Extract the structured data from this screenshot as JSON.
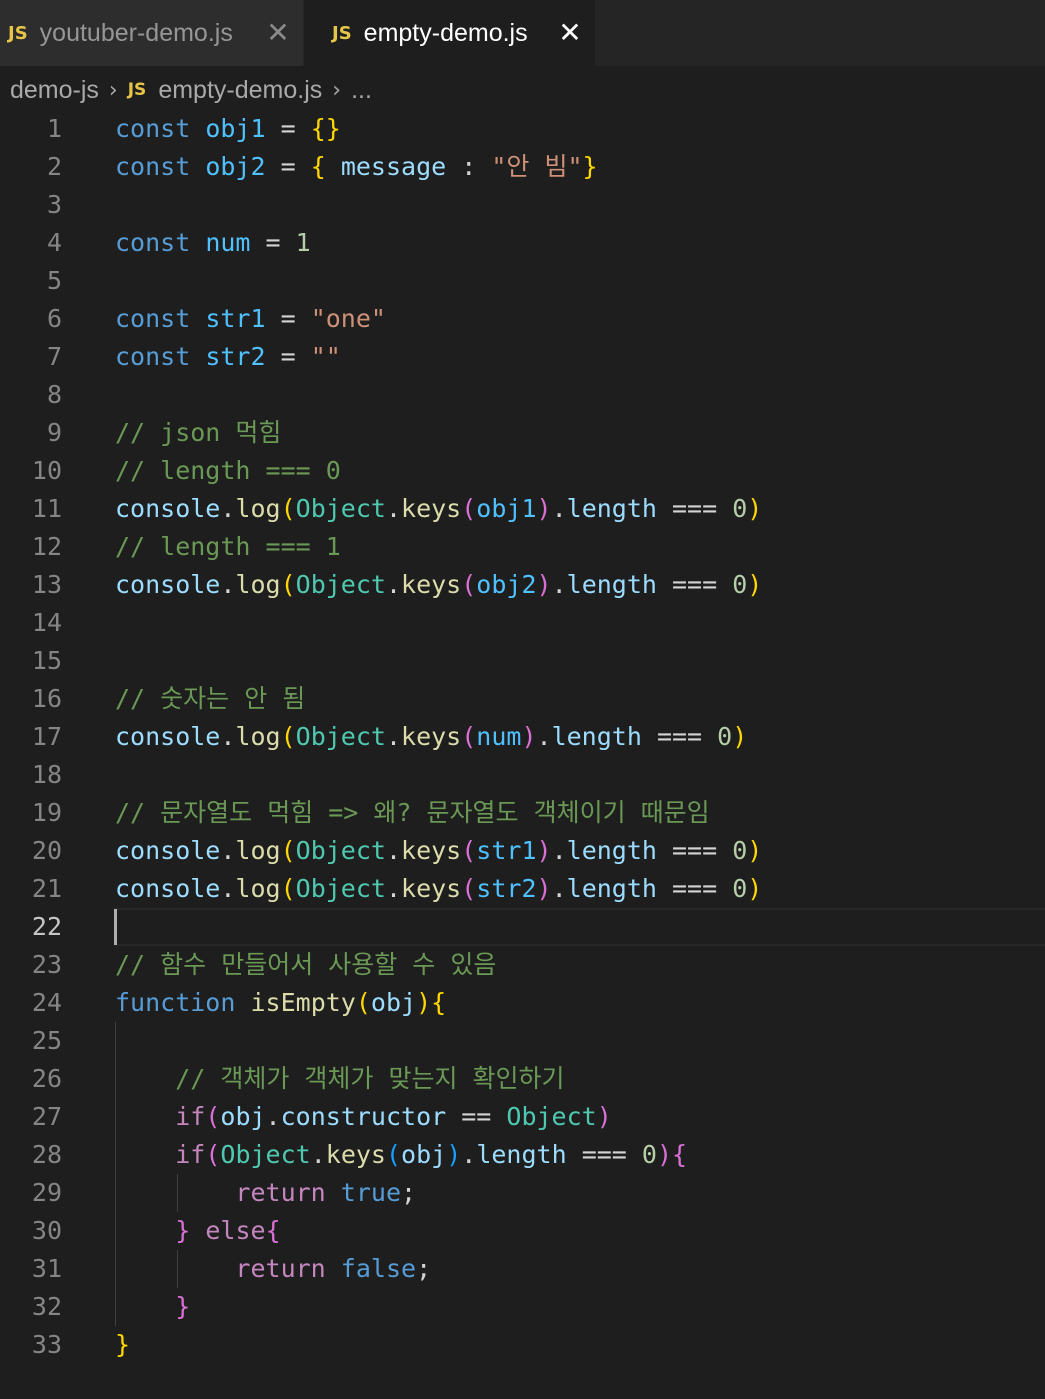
{
  "tabs": [
    {
      "badge": "JS",
      "label": "youtuber-demo.js",
      "close": "✕",
      "active": false
    },
    {
      "badge": "JS",
      "label": "empty-demo.js",
      "close": "✕",
      "active": true
    }
  ],
  "breadcrumb": {
    "folder": "demo-js",
    "sep": "›",
    "badge": "JS",
    "file": "empty-demo.js",
    "more": "..."
  },
  "editor": {
    "current_line": 22,
    "lines": [
      {
        "n": "1",
        "tokens": [
          [
            "kw",
            "const"
          ],
          [
            "op",
            " "
          ],
          [
            "const",
            "obj1"
          ],
          [
            "op",
            " = "
          ],
          [
            "b1",
            "{}"
          ]
        ]
      },
      {
        "n": "2",
        "tokens": [
          [
            "kw",
            "const"
          ],
          [
            "op",
            " "
          ],
          [
            "const",
            "obj2"
          ],
          [
            "op",
            " = "
          ],
          [
            "b1",
            "{"
          ],
          [
            "op",
            " "
          ],
          [
            "var",
            "message"
          ],
          [
            "op",
            " : "
          ],
          [
            "str",
            "\"안 빔\""
          ],
          [
            "b1",
            "}"
          ]
        ]
      },
      {
        "n": "3",
        "tokens": []
      },
      {
        "n": "4",
        "tokens": [
          [
            "kw",
            "const"
          ],
          [
            "op",
            " "
          ],
          [
            "const",
            "num"
          ],
          [
            "op",
            " = "
          ],
          [
            "num",
            "1"
          ]
        ]
      },
      {
        "n": "5",
        "tokens": []
      },
      {
        "n": "6",
        "tokens": [
          [
            "kw",
            "const"
          ],
          [
            "op",
            " "
          ],
          [
            "const",
            "str1"
          ],
          [
            "op",
            " = "
          ],
          [
            "str",
            "\"one\""
          ]
        ]
      },
      {
        "n": "7",
        "tokens": [
          [
            "kw",
            "const"
          ],
          [
            "op",
            " "
          ],
          [
            "const",
            "str2"
          ],
          [
            "op",
            " = "
          ],
          [
            "str",
            "\"\""
          ]
        ]
      },
      {
        "n": "8",
        "tokens": []
      },
      {
        "n": "9",
        "tokens": [
          [
            "com",
            "// json 먹힘"
          ]
        ]
      },
      {
        "n": "10",
        "tokens": [
          [
            "com",
            "// length === 0"
          ]
        ]
      },
      {
        "n": "11",
        "tokens": [
          [
            "var",
            "console"
          ],
          [
            "op",
            "."
          ],
          [
            "fn",
            "log"
          ],
          [
            "b1",
            "("
          ],
          [
            "cls",
            "Object"
          ],
          [
            "op",
            "."
          ],
          [
            "fn",
            "keys"
          ],
          [
            "b2",
            "("
          ],
          [
            "const",
            "obj1"
          ],
          [
            "b2",
            ")"
          ],
          [
            "op",
            "."
          ],
          [
            "var",
            "length"
          ],
          [
            "op",
            " === "
          ],
          [
            "num",
            "0"
          ],
          [
            "b1",
            ")"
          ]
        ]
      },
      {
        "n": "12",
        "tokens": [
          [
            "com",
            "// length === 1"
          ]
        ]
      },
      {
        "n": "13",
        "tokens": [
          [
            "var",
            "console"
          ],
          [
            "op",
            "."
          ],
          [
            "fn",
            "log"
          ],
          [
            "b1",
            "("
          ],
          [
            "cls",
            "Object"
          ],
          [
            "op",
            "."
          ],
          [
            "fn",
            "keys"
          ],
          [
            "b2",
            "("
          ],
          [
            "const",
            "obj2"
          ],
          [
            "b2",
            ")"
          ],
          [
            "op",
            "."
          ],
          [
            "var",
            "length"
          ],
          [
            "op",
            " === "
          ],
          [
            "num",
            "0"
          ],
          [
            "b1",
            ")"
          ]
        ]
      },
      {
        "n": "14",
        "tokens": []
      },
      {
        "n": "15",
        "tokens": []
      },
      {
        "n": "16",
        "tokens": [
          [
            "com",
            "// 숫자는 안 됨"
          ]
        ]
      },
      {
        "n": "17",
        "tokens": [
          [
            "var",
            "console"
          ],
          [
            "op",
            "."
          ],
          [
            "fn",
            "log"
          ],
          [
            "b1",
            "("
          ],
          [
            "cls",
            "Object"
          ],
          [
            "op",
            "."
          ],
          [
            "fn",
            "keys"
          ],
          [
            "b2",
            "("
          ],
          [
            "const",
            "num"
          ],
          [
            "b2",
            ")"
          ],
          [
            "op",
            "."
          ],
          [
            "var",
            "length"
          ],
          [
            "op",
            " === "
          ],
          [
            "num",
            "0"
          ],
          [
            "b1",
            ")"
          ]
        ]
      },
      {
        "n": "18",
        "tokens": []
      },
      {
        "n": "19",
        "tokens": [
          [
            "com",
            "// 문자열도 먹힘 => 왜? 문자열도 객체이기 때문임"
          ]
        ]
      },
      {
        "n": "20",
        "tokens": [
          [
            "var",
            "console"
          ],
          [
            "op",
            "."
          ],
          [
            "fn",
            "log"
          ],
          [
            "b1",
            "("
          ],
          [
            "cls",
            "Object"
          ],
          [
            "op",
            "."
          ],
          [
            "fn",
            "keys"
          ],
          [
            "b2",
            "("
          ],
          [
            "const",
            "str1"
          ],
          [
            "b2",
            ")"
          ],
          [
            "op",
            "."
          ],
          [
            "var",
            "length"
          ],
          [
            "op",
            " === "
          ],
          [
            "num",
            "0"
          ],
          [
            "b1",
            ")"
          ]
        ]
      },
      {
        "n": "21",
        "tokens": [
          [
            "var",
            "console"
          ],
          [
            "op",
            "."
          ],
          [
            "fn",
            "log"
          ],
          [
            "b1",
            "("
          ],
          [
            "cls",
            "Object"
          ],
          [
            "op",
            "."
          ],
          [
            "fn",
            "keys"
          ],
          [
            "b2",
            "("
          ],
          [
            "const",
            "str2"
          ],
          [
            "b2",
            ")"
          ],
          [
            "op",
            "."
          ],
          [
            "var",
            "length"
          ],
          [
            "op",
            " === "
          ],
          [
            "num",
            "0"
          ],
          [
            "b1",
            ")"
          ]
        ]
      },
      {
        "n": "22",
        "tokens": []
      },
      {
        "n": "23",
        "tokens": [
          [
            "com",
            "// 함수 만들어서 사용할 수 있음"
          ]
        ]
      },
      {
        "n": "24",
        "tokens": [
          [
            "kw",
            "function"
          ],
          [
            "op",
            " "
          ],
          [
            "fn",
            "isEmpty"
          ],
          [
            "b1",
            "("
          ],
          [
            "var",
            "obj"
          ],
          [
            "b1",
            ")"
          ],
          [
            "b1",
            "{"
          ]
        ]
      },
      {
        "n": "25",
        "tokens": []
      },
      {
        "n": "26",
        "tokens": [
          [
            "op",
            "    "
          ],
          [
            "com",
            "// 객체가 객체가 맞는지 확인하기"
          ]
        ]
      },
      {
        "n": "27",
        "tokens": [
          [
            "op",
            "    "
          ],
          [
            "ctl",
            "if"
          ],
          [
            "b2",
            "("
          ],
          [
            "var",
            "obj"
          ],
          [
            "op",
            "."
          ],
          [
            "var",
            "constructor"
          ],
          [
            "op",
            " == "
          ],
          [
            "cls",
            "Object"
          ],
          [
            "b2",
            ")"
          ]
        ]
      },
      {
        "n": "28",
        "tokens": [
          [
            "op",
            "    "
          ],
          [
            "ctl",
            "if"
          ],
          [
            "b2",
            "("
          ],
          [
            "cls",
            "Object"
          ],
          [
            "op",
            "."
          ],
          [
            "fn",
            "keys"
          ],
          [
            "b3",
            "("
          ],
          [
            "var",
            "obj"
          ],
          [
            "b3",
            ")"
          ],
          [
            "op",
            "."
          ],
          [
            "var",
            "length"
          ],
          [
            "op",
            " === "
          ],
          [
            "num",
            "0"
          ],
          [
            "b2",
            ")"
          ],
          [
            "b2",
            "{"
          ]
        ]
      },
      {
        "n": "29",
        "tokens": [
          [
            "op",
            "        "
          ],
          [
            "ctl",
            "return"
          ],
          [
            "op",
            " "
          ],
          [
            "kw",
            "true"
          ],
          [
            "op",
            ";"
          ]
        ]
      },
      {
        "n": "30",
        "tokens": [
          [
            "op",
            "    "
          ],
          [
            "b2",
            "}"
          ],
          [
            "op",
            " "
          ],
          [
            "ctl",
            "else"
          ],
          [
            "b2",
            "{"
          ]
        ]
      },
      {
        "n": "31",
        "tokens": [
          [
            "op",
            "        "
          ],
          [
            "ctl",
            "return"
          ],
          [
            "op",
            " "
          ],
          [
            "kw",
            "false"
          ],
          [
            "op",
            ";"
          ]
        ]
      },
      {
        "n": "32",
        "tokens": [
          [
            "op",
            "    "
          ],
          [
            "b2",
            "}"
          ]
        ]
      },
      {
        "n": "33",
        "tokens": [
          [
            "b1",
            "}"
          ]
        ]
      }
    ]
  }
}
